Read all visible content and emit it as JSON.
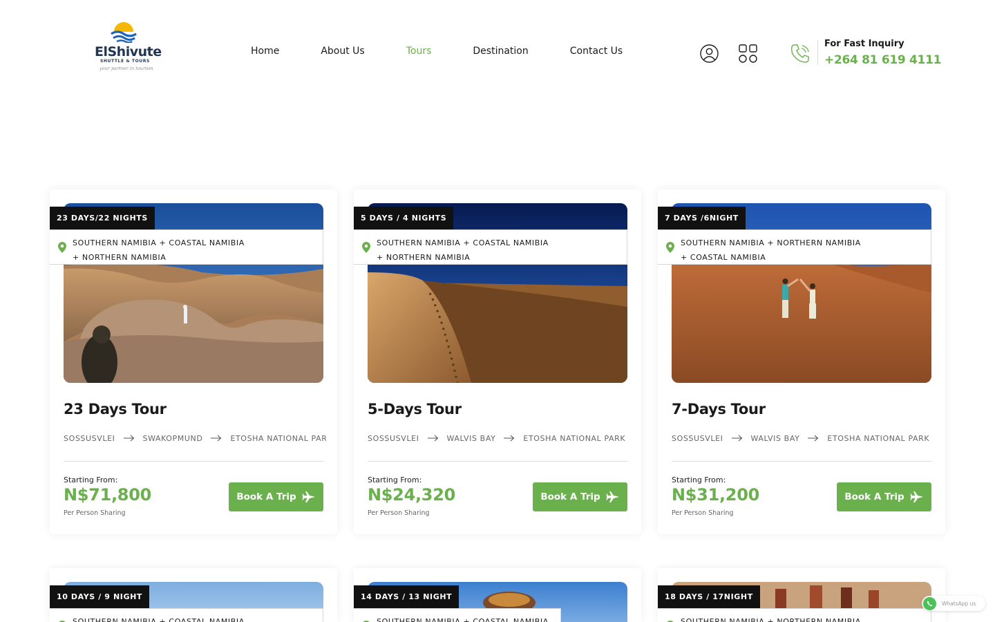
{
  "brand": {
    "name": "ElShivute",
    "subtitle": "SHUTTLE & TOURS",
    "tagline": "your partner in tourism"
  },
  "nav": {
    "items": [
      {
        "label": "Home",
        "active": false
      },
      {
        "label": "About Us",
        "active": false
      },
      {
        "label": "Tours",
        "active": true
      },
      {
        "label": "Destination",
        "active": false
      },
      {
        "label": "Contact Us",
        "active": false
      }
    ]
  },
  "inquiry": {
    "label": "For Fast Inquiry",
    "phone": "+264 81 619 4111"
  },
  "colors": {
    "accent": "#6ab04c",
    "dark": "#111111"
  },
  "tours": [
    {
      "duration": "23 DAYS/22 NIGHTS",
      "location_line1": "SOUTHERN NAMIBIA + COASTAL NAMIBIA",
      "location_line2": "+ NORTHERN NAMIBIA",
      "title": "23 Days Tour",
      "stops": [
        "SOSSUSVLEI",
        "SWAKOPMUND",
        "ETOSHA NATIONAL PARK"
      ],
      "starting_label": "Starting From:",
      "price": "N$71,800",
      "price_note": "Per Person Sharing",
      "button": "Book A Trip"
    },
    {
      "duration": "5 DAYS / 4 NIGHTS",
      "location_line1": "SOUTHERN NAMIBIA + COASTAL NAMIBIA",
      "location_line2": "+ NORTHERN NAMIBIA",
      "title": "5-Days Tour",
      "stops": [
        "SOSSUSVLEI",
        "WALVIS BAY",
        "ETOSHA NATIONAL PARK"
      ],
      "starting_label": "Starting From:",
      "price": "N$24,320",
      "price_note": "Per Person Sharing",
      "button": "Book A Trip"
    },
    {
      "duration": "7 DAYS /6NIGHT",
      "location_line1": "SOUTHERN NAMIBIA + NORTHERN NAMIBIA",
      "location_line2": "+ COASTAL NAMIBIA",
      "title": "7-Days Tour",
      "stops": [
        "SOSSUSVLEI",
        "WALVIS BAY",
        "ETOSHA NATIONAL PARK"
      ],
      "starting_label": "Starting From:",
      "price": "N$31,200",
      "price_note": "Per Person Sharing",
      "button": "Book A Trip"
    },
    {
      "duration": "10 DAYS / 9 NIGHT",
      "location_line1": "SOUTHERN NAMIBIA + COASTAL NAMIBIA",
      "location_line2": ""
    },
    {
      "duration": "14 DAYS / 13 NIGHT",
      "location_line1": "SOUTHERN NAMIBIA + COASTAL NAMIBIA",
      "location_line2": ""
    },
    {
      "duration": "18 DAYS / 17NIGHT",
      "location_line1": "SOUTHERN NAMIBIA + NORTHERN NAMIBIA",
      "location_line2": ""
    }
  ],
  "whatsapp": {
    "label": "WhatsApp us"
  }
}
